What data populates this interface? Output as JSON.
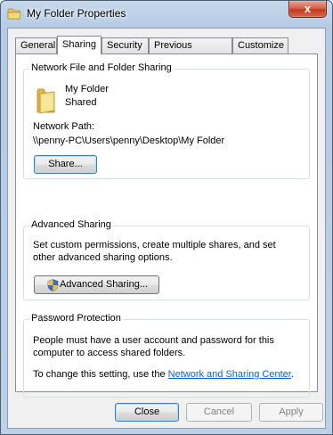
{
  "window": {
    "title": "My Folder Properties",
    "close_label": "x"
  },
  "tabs": [
    {
      "label": "General"
    },
    {
      "label": "Sharing"
    },
    {
      "label": "Security"
    },
    {
      "label": "Previous Versions"
    },
    {
      "label": "Customize"
    }
  ],
  "network_sharing": {
    "group_title": "Network File and Folder Sharing",
    "folder_name": "My Folder",
    "status": "Shared",
    "path_label": "Network Path:",
    "path_value": "\\\\penny-PC\\Users\\penny\\Desktop\\My Folder",
    "share_button": "Share..."
  },
  "advanced_sharing": {
    "group_title": "Advanced Sharing",
    "description": "Set custom permissions, create multiple shares, and set other advanced sharing options.",
    "button": "Advanced Sharing..."
  },
  "password_protection": {
    "group_title": "Password Protection",
    "description": "People must have a user account and password for this computer to access shared folders.",
    "change_prefix": "To change this setting, use the ",
    "link": "Network and Sharing Center",
    "change_suffix": "."
  },
  "footer": {
    "close": "Close",
    "cancel": "Cancel",
    "apply": "Apply"
  },
  "icons": {
    "title": "folder-icon",
    "folder": "folder-icon",
    "shield": "uac-shield-icon"
  }
}
